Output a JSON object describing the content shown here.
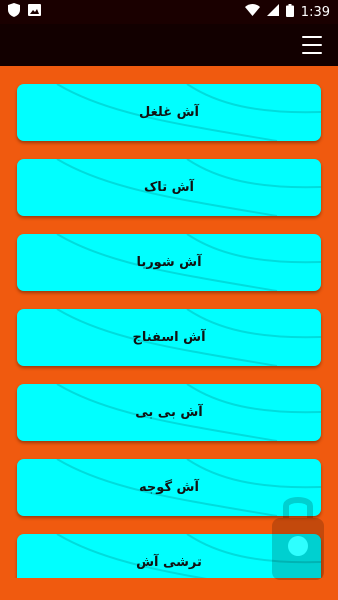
{
  "status_bar": {
    "time": "1:39",
    "left_icons": [
      "shield-icon",
      "image-icon"
    ],
    "right_icons": [
      "wifi-icon",
      "signal-icon",
      "battery-icon"
    ]
  },
  "toolbar": {
    "menu_icon": "hamburger-menu-icon"
  },
  "items": [
    {
      "label": "آش غلغل"
    },
    {
      "label": "آش تاک"
    },
    {
      "label": "آش شوربا"
    },
    {
      "label": "آش اسفناج"
    },
    {
      "label": "آش بی بی"
    },
    {
      "label": "آش گوجه"
    },
    {
      "label": "ترشی آش"
    }
  ],
  "colors": {
    "background": "#f05a0f",
    "item": "#00ffff",
    "toolbar": "#120000",
    "statusbar": "#1a0000"
  }
}
